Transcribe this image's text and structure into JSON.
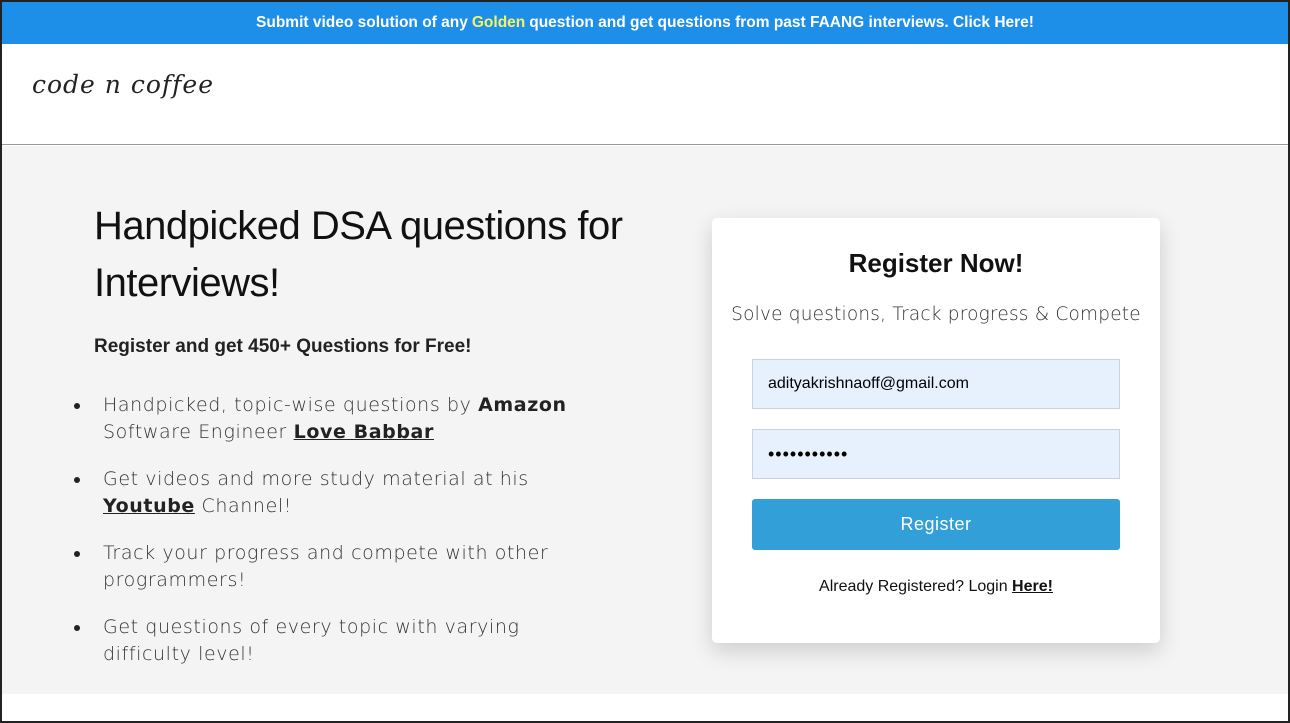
{
  "banner": {
    "text_before": "Submit video solution of any",
    "highlight": "Golden",
    "text_after": "question and get questions from past FAANG interviews. Click Here!",
    "background_color": "#1e8fe8",
    "highlight_color": "#f5f266"
  },
  "header": {
    "logo_text": "code n coffee"
  },
  "hero": {
    "headline": "Handpicked DSA questions for Interviews!",
    "subhead": "Register and get 450+ Questions for Free!",
    "features": [
      {
        "text_1": "Handpicked, topic-wise questions by ",
        "bold": "Amazon",
        "text_2": " Software Engineer ",
        "link": "Love Babbar"
      },
      {
        "text_1": "Get videos and more study material at his ",
        "link": "Youtube",
        "text_2": " Channel!"
      },
      {
        "text": "Track your progress and compete with other programmers!"
      },
      {
        "text": "Get questions of every topic with varying difficulty level!"
      }
    ]
  },
  "register_card": {
    "title": "Register Now!",
    "subtitle": "Solve questions, Track progress & Compete",
    "email_value": "adityakrishnaoff@gmail.com",
    "password_value": "•••••••••••",
    "button_label": "Register",
    "button_color": "#339fd8",
    "login_prompt": "Already Registered? Login ",
    "login_link": "Here!"
  }
}
